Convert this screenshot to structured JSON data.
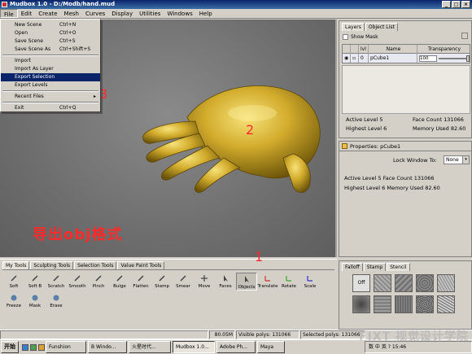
{
  "window": {
    "title": "Mudbox 1.0 - D:/Modb/hand.mud",
    "min": "_",
    "max": "□",
    "close": "×"
  },
  "menu": [
    "File",
    "Edit",
    "Create",
    "Mesh",
    "Curves",
    "Display",
    "Utilities",
    "Windows",
    "Help"
  ],
  "file_menu": {
    "new_scene": {
      "label": "New Scene",
      "shortcut": "Ctrl+N"
    },
    "open": {
      "label": "Open",
      "shortcut": "Ctrl+O"
    },
    "save_scene": {
      "label": "Save Scene",
      "shortcut": "Ctrl+S"
    },
    "save_scene_as": {
      "label": "Save Scene As",
      "shortcut": "Ctrl+Shift+S"
    },
    "import": {
      "label": "Import"
    },
    "import_as_layer": {
      "label": "Import As Layer"
    },
    "export_selection": {
      "label": "Export Selection"
    },
    "export_levels": {
      "label": "Export Levels"
    },
    "recent_files": {
      "label": "Recent Files",
      "arrow": "▸"
    },
    "exit": {
      "label": "Exit",
      "shortcut": "Ctrl+Q"
    }
  },
  "annotations": {
    "n1": "1",
    "n2": "2",
    "n3": "3",
    "note": "导出obj格式"
  },
  "layers_panel": {
    "tabs": [
      "Layers",
      "Object List"
    ],
    "show_mask": "Show Mask",
    "columns": [
      "",
      "",
      "lvl",
      "Name",
      "Transparency"
    ],
    "row": {
      "lvl": "0",
      "name": "pCube1",
      "transparency": "100"
    },
    "active_level": "Active Level 5",
    "face_count": "Face Count 131066",
    "highest_level": "Highest Level 6",
    "memory_used": "Memory Used 82.60"
  },
  "properties_panel": {
    "title": "Properties: pCube1",
    "lock_window": "Lock Window To:",
    "lock_value": "None",
    "line1": "Active Level 5   Face Count 131066",
    "line2": "Highest Level 6 Memory Used 82.60"
  },
  "bottom_tabs": [
    "My Tools",
    "Sculpting Tools",
    "Selection Tools",
    "Value Paint Tools"
  ],
  "tools": [
    "Soft",
    "Soft B",
    "Scratch",
    "Smooth",
    "Pinch",
    "Bulge",
    "Flatten",
    "Stamp",
    "Smear",
    "Move",
    "Faces",
    "Objects",
    "Translate",
    "Rotate",
    "Scale",
    "Freeze",
    "Mask",
    "Erase"
  ],
  "stencil_panel": {
    "tabs": [
      "Falloff",
      "Stamp",
      "Stencil"
    ],
    "off_label": "Off"
  },
  "status": {
    "mem": "80.05M",
    "visible_polys": "Visible polys: 131066",
    "selected_polys": "Selected polys: 131066"
  },
  "taskbar": {
    "start": "开始",
    "buttons": [
      "Funshion",
      "B Windo...",
      "火星时代...",
      "Mudbox 1.0...",
      "Adobe Ph...",
      "Maya"
    ],
    "tray": "数 中 英 ? 15:46"
  },
  "watermark": "FIXT 视觉设计学院"
}
